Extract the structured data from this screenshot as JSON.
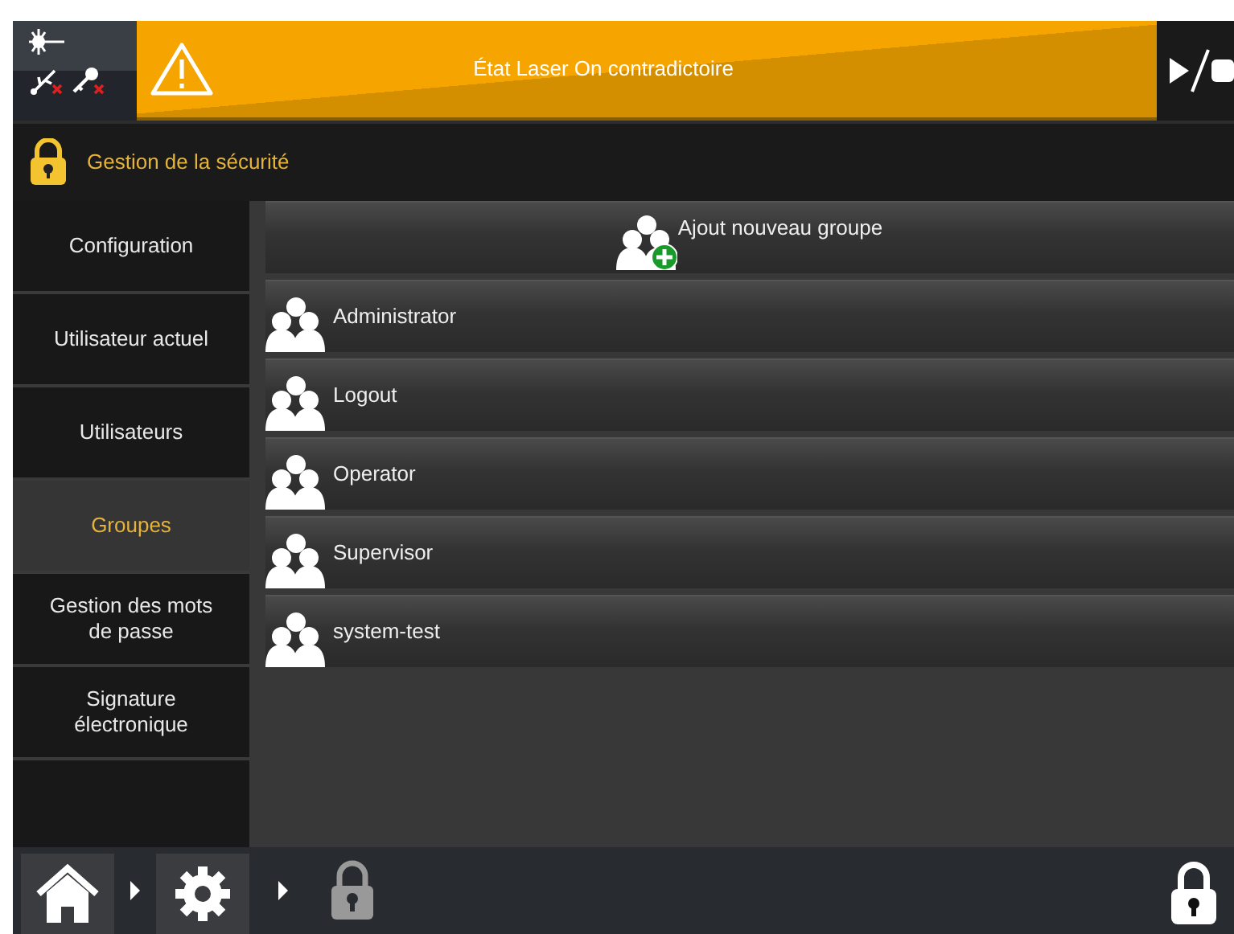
{
  "header": {
    "alert": "État Laser On contradictoire"
  },
  "title": "Gestion de la sécurité",
  "sidebar": {
    "items": [
      {
        "label": "Configuration",
        "selected": false
      },
      {
        "label": "Utilisateur actuel",
        "selected": false
      },
      {
        "label": "Utilisateurs",
        "selected": false
      },
      {
        "label": "Groupes",
        "selected": true
      },
      {
        "label": "Gestion des mots de passe",
        "selected": false
      },
      {
        "label": "Signature électronique",
        "selected": false
      }
    ]
  },
  "add_group": "Ajout nouveau groupe",
  "groups": [
    "Administrator",
    "Logout",
    "Operator",
    "Supervisor",
    "system-test"
  ]
}
